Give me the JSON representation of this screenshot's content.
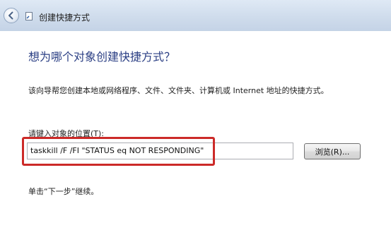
{
  "window": {
    "title": "创建快捷方式",
    "back_icon": "back-arrow-icon"
  },
  "main": {
    "heading": "想为哪个对象创建快捷方式？",
    "description": "该向导帮您创建本地或网络程序、文件、文件夹、计算机或 Internet 地址的快捷方式。",
    "location_label": "请键入对象的位置(T):",
    "location_value": "taskkill /F /FI  \"STATUS eq NOT RESPONDING\"",
    "browse_label": "浏览(R)...",
    "hint": "单击“下一步”继续。"
  },
  "colors": {
    "heading": "#2b3f84",
    "highlight": "#cc2a28"
  }
}
